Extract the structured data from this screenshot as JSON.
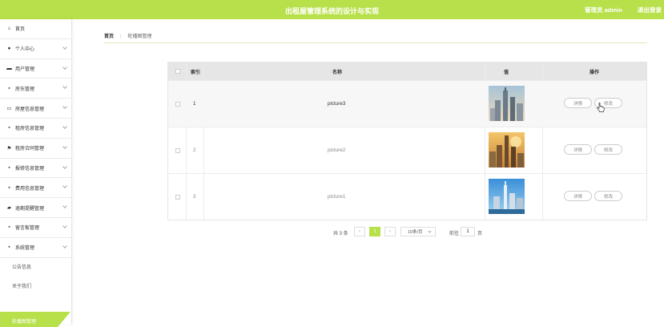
{
  "header": {
    "title": "出租屋管理系统的设计与实现",
    "admin": "管理员 admin",
    "logout": "退出登录"
  },
  "sidebar": {
    "items": [
      {
        "label": "首页",
        "icon": "home-icon",
        "has_arrow": false
      },
      {
        "label": "个人中心",
        "icon": "person-icon",
        "has_arrow": true
      },
      {
        "label": "用户管理",
        "icon": "group-icon",
        "has_arrow": true
      },
      {
        "label": "房东管理",
        "icon": "grid-icon",
        "has_arrow": true
      },
      {
        "label": "房屋信息管理",
        "icon": "id-card-icon",
        "has_arrow": true
      },
      {
        "label": "租房信息管理",
        "icon": "grid-icon",
        "has_arrow": true
      },
      {
        "label": "租房合同管理",
        "icon": "flag-icon",
        "has_arrow": true
      },
      {
        "label": "报修信息管理",
        "icon": "grid-icon",
        "has_arrow": true
      },
      {
        "label": "费用信息管理",
        "icon": "grid-icon",
        "has_arrow": true
      },
      {
        "label": "逾期提醒管理",
        "icon": "message-icon",
        "has_arrow": true
      },
      {
        "label": "留言板管理",
        "icon": "grid-icon",
        "has_arrow": true
      },
      {
        "label": "系统管理",
        "icon": "grid-icon",
        "has_arrow": true
      }
    ],
    "sub_items": [
      {
        "label": "公告信息"
      },
      {
        "label": "关于我们"
      },
      {
        "label": "轮播图管理"
      }
    ],
    "accent": "#b8e04a"
  },
  "breadcrumb": {
    "home": "首页",
    "separator": "⋮",
    "current": "轮播图管理"
  },
  "table": {
    "headers": {
      "index": "索引",
      "name": "名称",
      "value": "值",
      "actions": "操作"
    },
    "rows": [
      {
        "index": "1",
        "name": "picture3",
        "detail": "详情",
        "edit": "修改"
      },
      {
        "index": "2",
        "name": "picture2",
        "detail": "详情",
        "edit": "修改"
      },
      {
        "index": "3",
        "name": "picture1",
        "detail": "详情",
        "edit": "修改"
      }
    ]
  },
  "pagination": {
    "total": "共 3 条",
    "prev": "‹",
    "current_page": "1",
    "next": "›",
    "page_size": "10条/页",
    "goto_label": "前往",
    "goto_value": "1",
    "page_unit": "页"
  },
  "colors": {
    "header_bg": "#b8e04a",
    "active_page": "#b8e04a"
  }
}
